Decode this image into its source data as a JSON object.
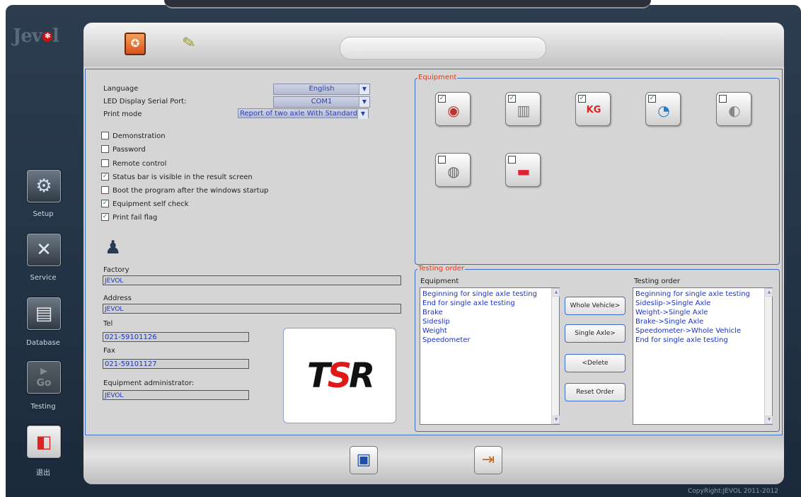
{
  "app": {
    "logo_text": "Jev",
    "logo_mark": "✻",
    "copyright": "CopyRight:JEVOL 2011-2012"
  },
  "nav": {
    "items": [
      {
        "label": "Setup",
        "icon": "gear-icon"
      },
      {
        "label": "Service",
        "icon": "tools-icon"
      },
      {
        "label": "Database",
        "icon": "database-icon"
      },
      {
        "label": "Testing",
        "icon": "go-icon"
      },
      {
        "label": "退出",
        "icon": "exit-icon"
      }
    ],
    "go_text": "Go"
  },
  "header": {
    "tab1_icon": "settings-tab-icon",
    "tab2_icon": "pencil-tab-icon"
  },
  "settings": {
    "language_label": "Language",
    "language_value": "English",
    "serial_label": "LED Display Serial Port:",
    "serial_value": "COM1",
    "print_label": "Print mode",
    "print_value": "Report of two axle With Standard",
    "checkboxes": [
      {
        "label": "Demonstration",
        "checked": false
      },
      {
        "label": "Password",
        "checked": false
      },
      {
        "label": "Remote control",
        "checked": false
      },
      {
        "label": "Status bar is visible in the result screen",
        "checked": true
      },
      {
        "label": "Boot the program after the windows startup",
        "checked": false
      },
      {
        "label": "Equipment self check",
        "checked": true
      },
      {
        "label": "Print fail flag",
        "checked": true
      }
    ]
  },
  "company": {
    "factory_label": "Factory",
    "factory_value": "JEVOL",
    "address_label": "Address",
    "address_value": "JEVOL",
    "tel_label": "Tel",
    "tel_value": "021-59101126",
    "fax_label": "Fax",
    "fax_value": "021-59101127",
    "admin_label": "Equipment administrator:",
    "admin_value": "JEVOL",
    "logo_text": "TSR"
  },
  "equipment_group": {
    "title": "Equipment",
    "items": [
      {
        "icon": "brake-disc-icon",
        "checked": true
      },
      {
        "icon": "sideslip-icon",
        "checked": true
      },
      {
        "icon": "weight-icon",
        "checked": true
      },
      {
        "icon": "speedometer-icon",
        "checked": true
      },
      {
        "icon": "headlight-icon",
        "checked": false
      },
      {
        "icon": "exhaust-icon",
        "checked": false
      },
      {
        "icon": "trailer-icon",
        "checked": false
      }
    ]
  },
  "testing_order": {
    "title": "Testing order",
    "left_header": "Equipment",
    "right_header": "Testing order",
    "left_items": [
      "Beginning for single axle testing",
      "End for single axle testing",
      "Brake",
      "Sideslip",
      "Weight",
      "Speedometer"
    ],
    "right_items": [
      "Beginning for single axle testing",
      "Sideslip->Single Axle",
      "Weight->Single Axle",
      "Brake->Single Axle",
      "Speedometer->Whole Vehicle",
      "End for single axle testing"
    ],
    "buttons": [
      "Whole Vehicle>",
      "Single Axle>",
      "<Delete",
      "Reset Order"
    ]
  },
  "footer": {
    "save_icon": "save-icon",
    "exit_icon": "exit-door-icon"
  },
  "colors": {
    "accent_blue": "#3b6fc7",
    "title_red": "#e23b1a",
    "value_blue": "#1b34b8",
    "check_green": "#2a8a2a"
  }
}
